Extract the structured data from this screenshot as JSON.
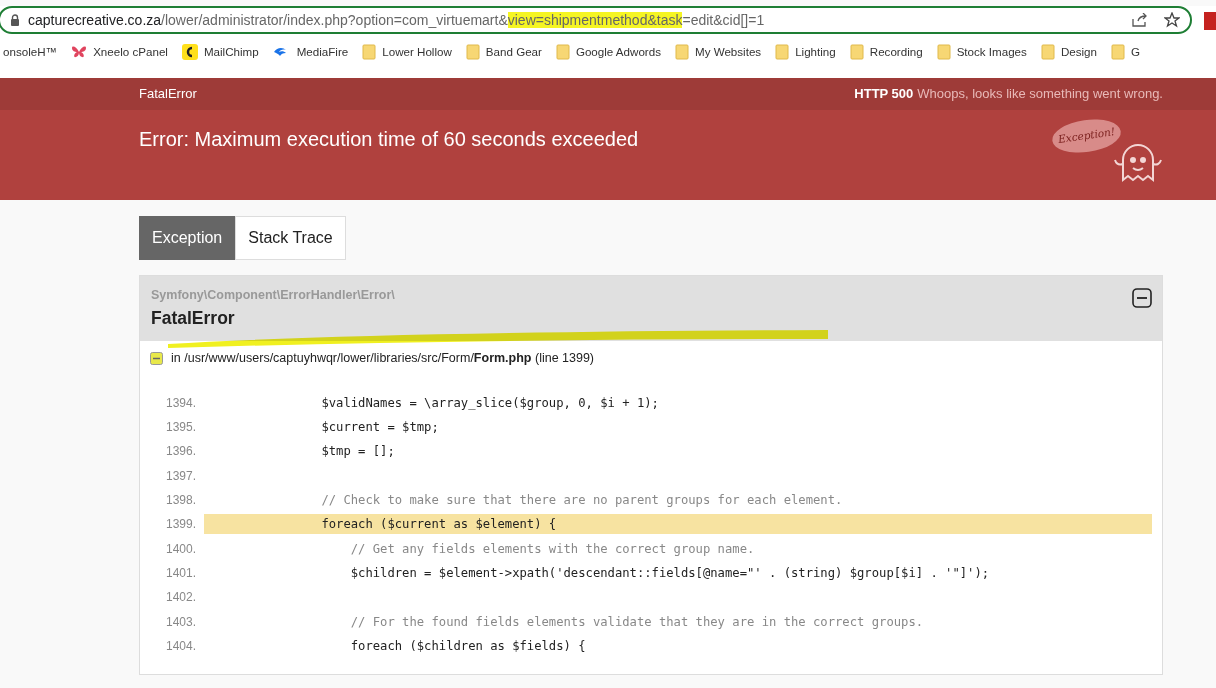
{
  "browser": {
    "url": [
      {
        "text": "capturecreative.co.za",
        "kind": "host",
        "marked": false
      },
      {
        "text": "/lower/administrator/index.php?option=com_virtuemart&",
        "kind": "path",
        "marked": false
      },
      {
        "text": "view=shipmentmethod&task",
        "kind": "path",
        "marked": true
      },
      {
        "text": "=edit&cid[]=1",
        "kind": "path",
        "marked": false
      }
    ],
    "bookmarks": [
      {
        "label": "onsoleH™",
        "kind": "plain"
      },
      {
        "label": "Xneelo cPanel",
        "kind": "butterfly"
      },
      {
        "label": "MailChimp",
        "kind": "chimp"
      },
      {
        "label": "MediaFire",
        "kind": "flame"
      },
      {
        "label": "Lower Hollow",
        "kind": "folder"
      },
      {
        "label": "Band Gear",
        "kind": "folder"
      },
      {
        "label": "Google Adwords",
        "kind": "folder"
      },
      {
        "label": "My Websites",
        "kind": "folder"
      },
      {
        "label": "Lighting",
        "kind": "folder"
      },
      {
        "label": "Recording",
        "kind": "folder"
      },
      {
        "label": "Stock Images",
        "kind": "folder"
      },
      {
        "label": "Design",
        "kind": "folder"
      },
      {
        "label": "G",
        "kind": "folder"
      }
    ]
  },
  "error_header": {
    "title": "FatalError",
    "status_code": "HTTP 500",
    "status_text": "Whoops, looks like something went wrong.",
    "message": "Error: Maximum execution time of 60 seconds exceeded",
    "badge": "Exception!"
  },
  "tabs": [
    {
      "label": "Exception",
      "selected": true
    },
    {
      "label": "Stack Trace",
      "selected": false
    }
  ],
  "exception": {
    "namespace": "Symfony\\Component\\ErrorHandler\\Error\\",
    "class": "FatalError",
    "expanded": true,
    "location": {
      "prefix": "in",
      "path": "/usr/www/users/captuyhwqr/lower/libraries/src/Form/",
      "file": "Form.php",
      "line": "(line 1399)"
    },
    "code": [
      {
        "number": "1394.",
        "text": "                $validNames = \\array_slice($group, 0, $i + 1);",
        "kind": "code",
        "highlighted": false
      },
      {
        "number": "1395.",
        "text": "                $current = $tmp;",
        "kind": "code",
        "highlighted": false
      },
      {
        "number": "1396.",
        "text": "                $tmp = [];",
        "kind": "code",
        "highlighted": false
      },
      {
        "number": "1397.",
        "kind": "code",
        "highlighted": false
      },
      {
        "number": "1398.",
        "text": "                // Check to make sure that there are no parent groups for each element.",
        "kind": "comment",
        "highlighted": false
      },
      {
        "number": "1399.",
        "text": "                foreach ($current as $element) {",
        "kind": "code",
        "highlighted": true
      },
      {
        "number": "1400.",
        "text": "                    // Get any fields elements with the correct group name.",
        "kind": "comment",
        "highlighted": false
      },
      {
        "number": "1401.",
        "text": "                    $children = $element->xpath('descendant::fields[@name=\"' . (string) $group[$i] . '\"]');",
        "kind": "code",
        "highlighted": false
      },
      {
        "number": "1402.",
        "kind": "code",
        "highlighted": false
      },
      {
        "number": "1403.",
        "text": "                    // For the found fields elements validate that they are in the correct groups.",
        "kind": "comment",
        "highlighted": false
      },
      {
        "number": "1404.",
        "text": "                    foreach ($children as $fields) {",
        "kind": "code",
        "highlighted": false
      }
    ]
  }
}
